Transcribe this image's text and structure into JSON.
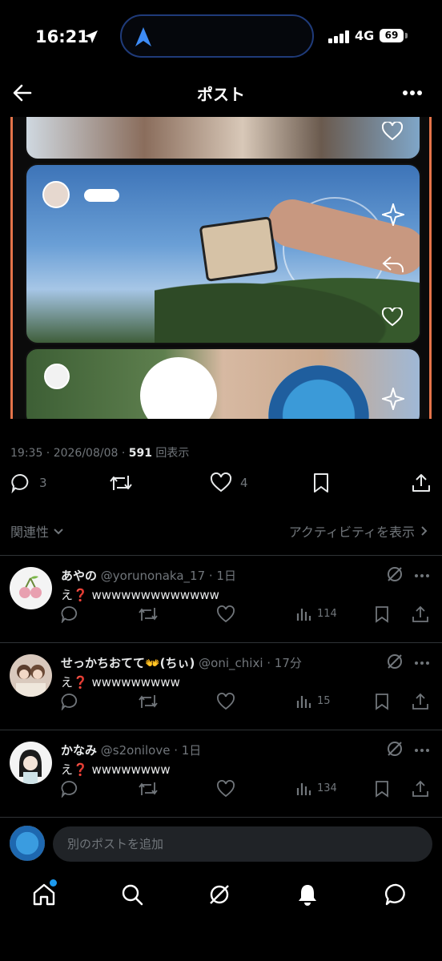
{
  "status_bar": {
    "time": "16:21",
    "network": "4G",
    "battery": "69"
  },
  "header": {
    "title": "ポスト"
  },
  "post": {
    "timestamp": "19:35 · 2026/08/08 · ",
    "views_count": "591",
    "views_label": " 回表示",
    "replies": "3",
    "likes": "4"
  },
  "sort": {
    "relevance_label": "関連性",
    "activity_label": "アクティビティを表示"
  },
  "replies": [
    {
      "name": "あやの",
      "handle": "@yorunonaka_17 · 1日",
      "text": "え❓ wwwwwwwwwwwww",
      "views": "114"
    },
    {
      "name": "せっかちおてて👐(ちぃ)",
      "handle": "@oni_chixi · 17分",
      "text": "え❓ wwwwwwwww",
      "views": "15"
    },
    {
      "name": "かなみ",
      "handle": "@s2onilove · 1日",
      "text": "え❓ wwwwwwww",
      "views": "134"
    }
  ],
  "compose": {
    "placeholder": "別のポストを追加"
  },
  "colors": {
    "accent": "#1d9bf0",
    "muted": "#71767b",
    "frame": "#e4744a",
    "background": "#000000"
  },
  "icons": [
    "location-arrow-icon",
    "back-arrow-icon",
    "more-icon",
    "reply-icon",
    "repost-icon",
    "like-icon",
    "bookmark-icon",
    "share-icon",
    "views-icon",
    "grok-icon",
    "home-icon",
    "search-icon",
    "notifications-icon",
    "messages-icon"
  ]
}
